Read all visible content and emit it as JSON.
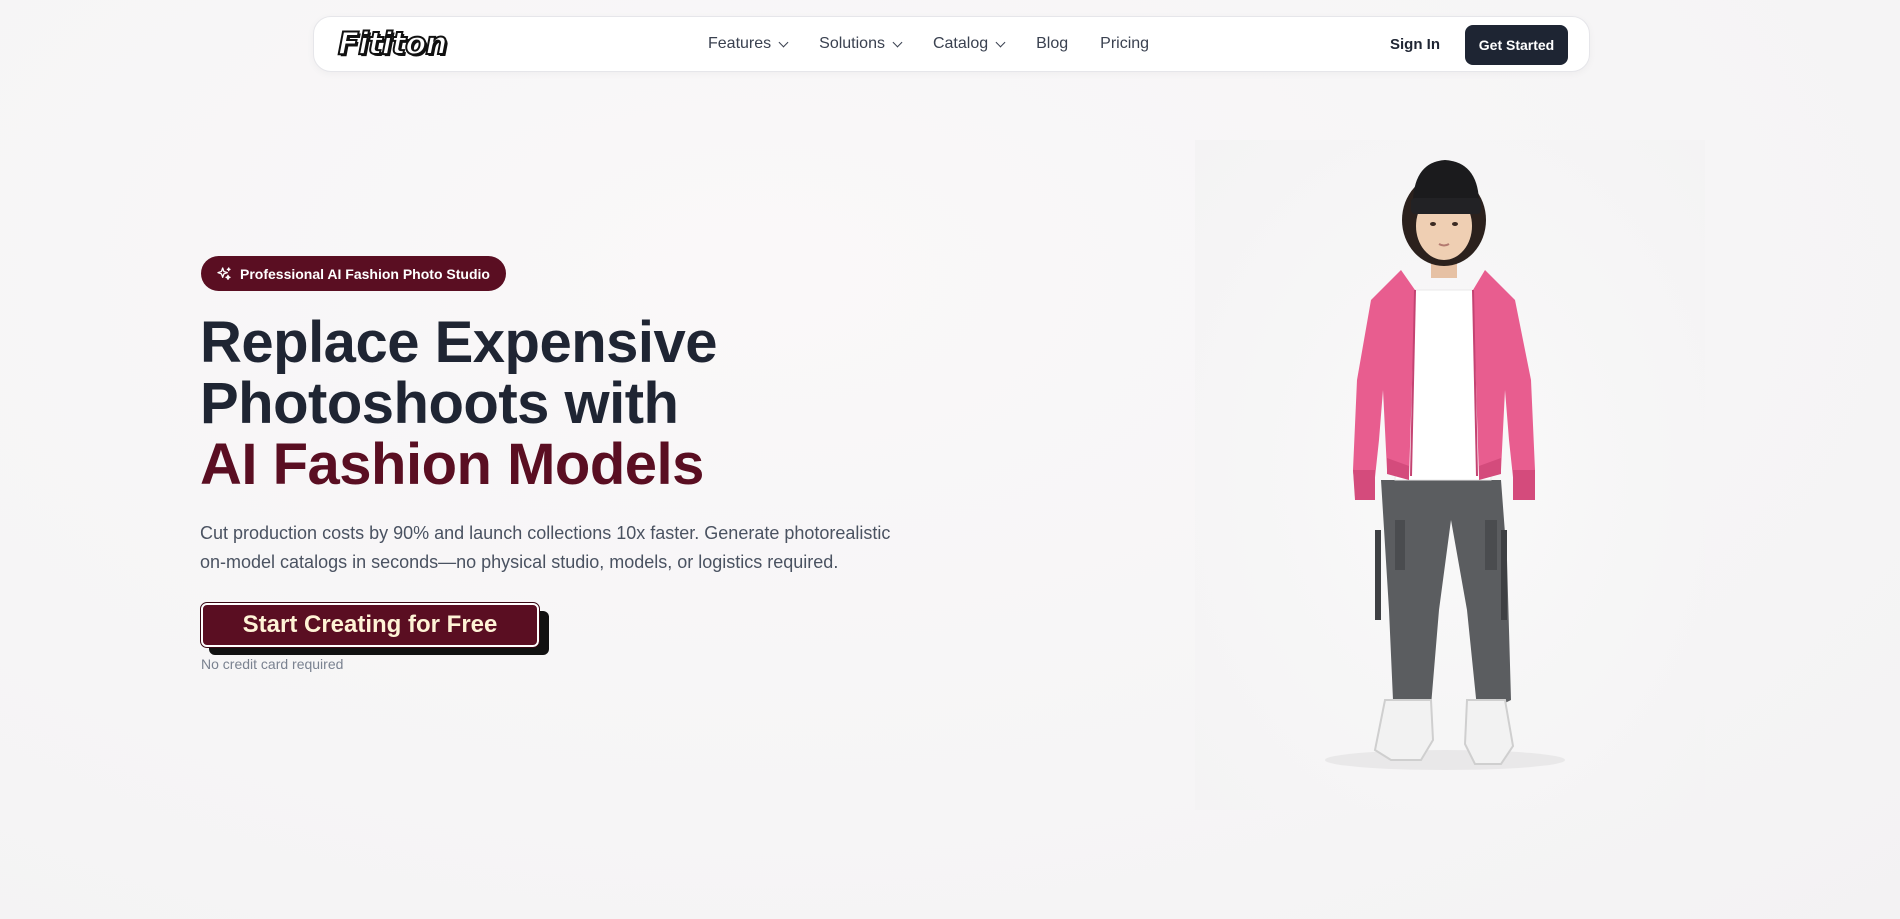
{
  "nav": {
    "logo": "Fititon",
    "links": [
      {
        "label": "Features",
        "dropdown": true
      },
      {
        "label": "Solutions",
        "dropdown": true
      },
      {
        "label": "Catalog",
        "dropdown": true
      },
      {
        "label": "Blog",
        "dropdown": false
      },
      {
        "label": "Pricing",
        "dropdown": false
      }
    ],
    "sign_in": "Sign In",
    "get_started": "Get Started"
  },
  "hero": {
    "badge": "Professional AI Fashion Photo Studio",
    "headline_line1": "Replace Expensive",
    "headline_line2": "Photoshoots with",
    "headline_accent": "AI Fashion Models",
    "subtext": "Cut production costs by 90% and launch collections 10x faster. Generate photorealistic on-model catalogs in seconds—no physical studio, models, or logistics required.",
    "cta": "Start Creating for Free",
    "cta_note": "No credit card required"
  },
  "colors": {
    "brand": "#5a0e22",
    "dark": "#1e2533",
    "cta_text": "#fff3d6",
    "background": "#f6f5f6"
  },
  "icons": {
    "badge_icon": "sparkles-icon",
    "nav_dropdown_icon": "chevron-down-icon"
  }
}
